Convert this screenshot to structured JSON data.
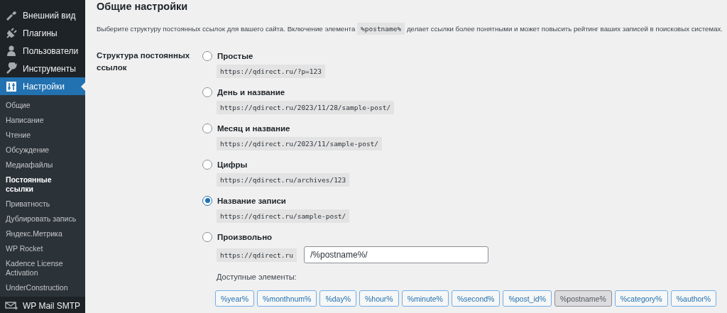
{
  "sidebar": {
    "menu": [
      {
        "label": "Внешний вид",
        "selected": false
      },
      {
        "label": "Плагины",
        "selected": false
      },
      {
        "label": "Пользователи",
        "selected": false
      },
      {
        "label": "Инструменты",
        "selected": false
      },
      {
        "label": "Настройки",
        "selected": true
      }
    ],
    "submenu": [
      {
        "label": "Общие",
        "selected": false
      },
      {
        "label": "Написание",
        "selected": false
      },
      {
        "label": "Чтение",
        "selected": false
      },
      {
        "label": "Обсуждение",
        "selected": false
      },
      {
        "label": "Медиафайлы",
        "selected": false
      },
      {
        "label": "Постоянные ссылки",
        "selected": true
      },
      {
        "label": "Приватность",
        "selected": false
      },
      {
        "label": "Дублировать запись",
        "selected": false
      },
      {
        "label": "Яндекс.Метрика",
        "selected": false
      },
      {
        "label": "WP Rocket",
        "selected": false
      },
      {
        "label": "Kadence License Activation",
        "selected": false
      },
      {
        "label": "UnderConstruction",
        "selected": false
      }
    ],
    "footer_item": {
      "label": "WP Mail SMTP"
    }
  },
  "main": {
    "title": "Общие настройки",
    "description": {
      "before": "Выберите структуру постоянных ссылок для вашего сайта. Включение элемента",
      "code": "%postname%",
      "after": "делает ссылки более понятными и может повысить рейтинг ваших записей в поисковых системах."
    },
    "field_label": "Структура постоянных ссылок",
    "options": [
      {
        "label": "Простые",
        "example": "https://qdirect.ru/?p=123",
        "selected": false
      },
      {
        "label": "День и название",
        "example": "https://qdirect.ru/2023/11/28/sample-post/",
        "selected": false
      },
      {
        "label": "Месяц и название",
        "example": "https://qdirect.ru/2023/11/sample-post/",
        "selected": false
      },
      {
        "label": "Цифры",
        "example": "https://qdirect.ru/archives/123",
        "selected": false
      },
      {
        "label": "Название записи",
        "example": "https://qdirect.ru/sample-post/",
        "selected": true
      },
      {
        "label": "Произвольно",
        "selected": false
      }
    ],
    "custom": {
      "prefix": "https://qdirect.ru",
      "value": "/%postname%/",
      "tags_label": "Доступные элементы:",
      "tags": [
        {
          "label": "%year%",
          "selected": false
        },
        {
          "label": "%monthnum%",
          "selected": false
        },
        {
          "label": "%day%",
          "selected": false
        },
        {
          "label": "%hour%",
          "selected": false
        },
        {
          "label": "%minute%",
          "selected": false
        },
        {
          "label": "%second%",
          "selected": false
        },
        {
          "label": "%post_id%",
          "selected": false
        },
        {
          "label": "%postname%",
          "selected": true
        },
        {
          "label": "%category%",
          "selected": false
        },
        {
          "label": "%author%",
          "selected": false
        }
      ]
    }
  }
}
